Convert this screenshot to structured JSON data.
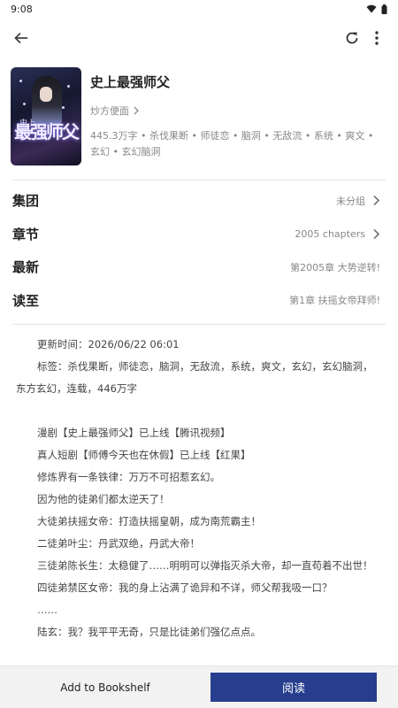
{
  "status": {
    "time": "9:08"
  },
  "icons": {
    "back": "arrow-left-icon",
    "refresh": "refresh-icon",
    "more": "more-vertical-icon"
  },
  "book": {
    "cover_text": "最强师父",
    "cover_sub": "史上",
    "title": "史上最强师父",
    "author": "炒方便面",
    "tags": "445.3万字 • 杀伐果断 • 师徒恋 • 脑洞 • 无敌流 • 系统 • 爽文 • 玄幻 • 玄幻脑洞"
  },
  "rows": [
    {
      "label": "集团",
      "value": "未分组",
      "chevron": true
    },
    {
      "label": "章节",
      "value": "2005 chapters",
      "chevron": true
    },
    {
      "label": "最新",
      "value": "第2005章 大势逆转!",
      "chevron": false
    },
    {
      "label": "读至",
      "value": "第1章 扶摇女帝拜师!",
      "chevron": false
    }
  ],
  "intro": {
    "updated": "更新时间：2026/06/22 06:01",
    "tags_line": "标签：杀伐果断，师徒恋，脑洞，无敌流，系统，爽文，玄幻，玄幻脑洞，东方玄幻，连载，446万字",
    "lines": [
      "漫剧【史上最强师父】已上线【腾讯视频】",
      "真人短剧【师傅今天也在休假】已上线【红果】",
      "修炼界有一条铁律：万万不可招惹玄幻。",
      "因为他的徒弟们都太逆天了！",
      "大徒弟扶摇女帝：打造扶摇皇朝，成为南荒霸主！",
      "二徒弟叶尘：丹武双绝，丹武大帝！",
      "三徒弟陈长生：太稳健了……明明可以弹指灭杀大帝，却一直苟着不出世！",
      "四徒弟禁区女帝：我的身上沾满了诡异和不详，师父帮我吸一口？",
      "……",
      "陆玄：我？我平平无奇，只是比徒弟们强亿点点。"
    ]
  },
  "bottom": {
    "bookshelf_label": "Add to Bookshelf",
    "read_label": "阅读",
    "accent": "#273e8f"
  }
}
